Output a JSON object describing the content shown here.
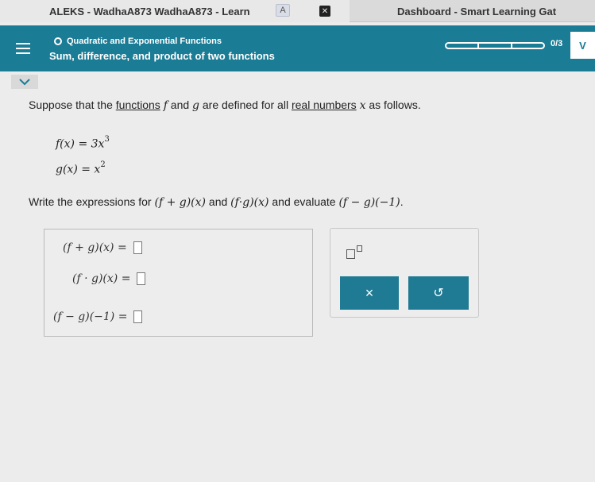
{
  "browser": {
    "tab_title": "ALEKS - WadhaA873 WadhaA873 - Learn",
    "tab_badge": "A",
    "tab_close": "✕",
    "tab2_title": "Dashboard - Smart Learning Gat"
  },
  "header": {
    "topic": "Quadratic and Exponential Functions",
    "subtopic": "Sum, difference, and product of two functions",
    "progress_count": "0/3",
    "progress": {
      "completed": 0,
      "total": 3
    },
    "side_button": "V",
    "bg_color": "#1b7c95"
  },
  "question": {
    "p1": "Suppose that the ",
    "functions_link": "functions",
    "p2": " ",
    "f": "f",
    "p3": " and ",
    "g": "g",
    "p4": " are defined for all ",
    "real_link": "real numbers",
    "p5": " ",
    "x": "x",
    "p6": " as follows."
  },
  "definitions": {
    "f_lhs": "f(x) = 3x",
    "f_exp": "3",
    "g_lhs": "g(x) = x",
    "g_exp": "2"
  },
  "instruction": {
    "t1": "Write the expressions for ",
    "e1": "(f + g)(x)",
    "t2": " and ",
    "e2": "(f·g)(x)",
    "t3": " and evaluate ",
    "e3": "(f − g)(−1)",
    "t4": "."
  },
  "answers": {
    "row1": "(f + g)(x) =",
    "row2": "(f · g)(x) =",
    "row3": "(f − g)(−1) ="
  },
  "tools": {
    "clear_label": "×",
    "undo_label": "↺"
  },
  "icons": [
    "menu-icon",
    "chevron-down-icon",
    "exponent-icon",
    "undo-icon",
    "close-icon"
  ]
}
